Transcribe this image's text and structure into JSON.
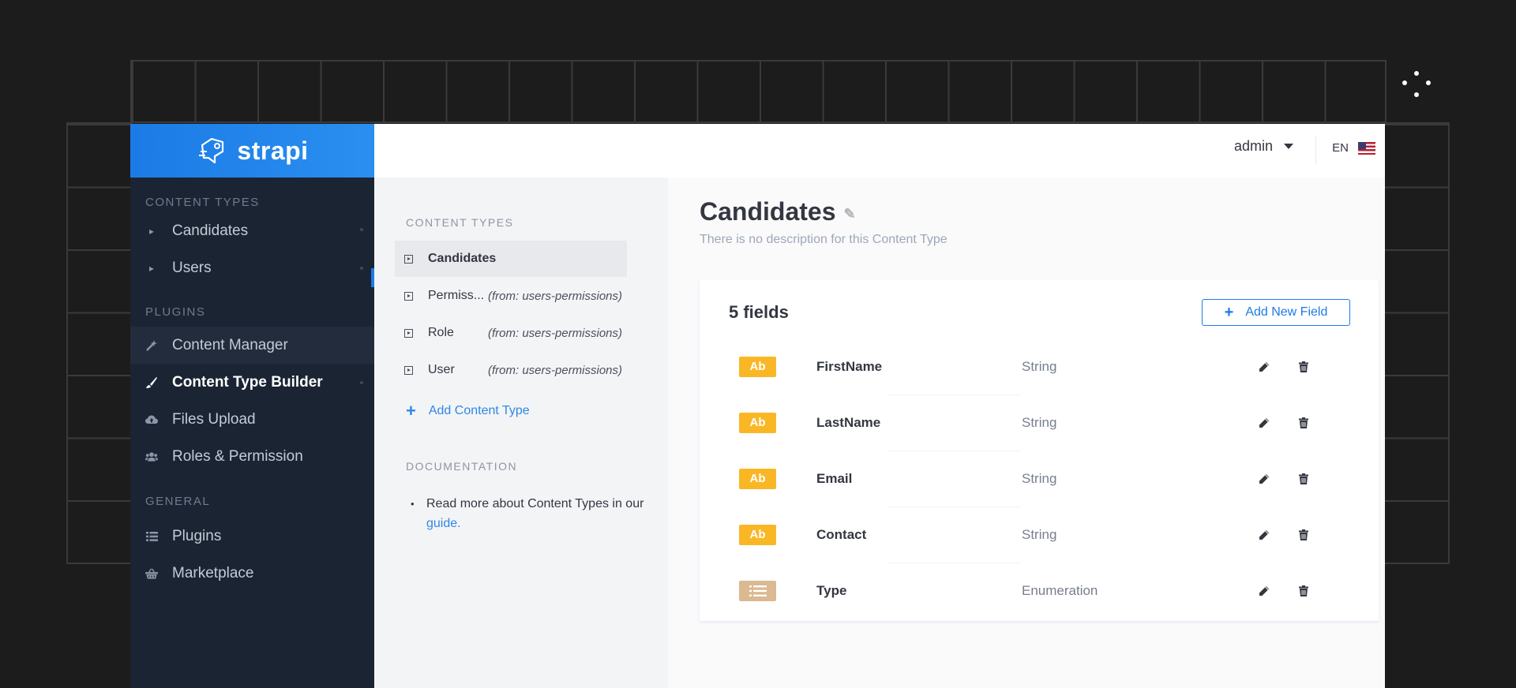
{
  "logo": {
    "text": "strapi"
  },
  "sidebar": {
    "sections": [
      {
        "title": "CONTENT TYPES",
        "items": [
          {
            "label": "Candidates",
            "icon": "caret-right-icon"
          },
          {
            "label": "Users",
            "icon": "caret-right-icon"
          }
        ]
      },
      {
        "title": "PLUGINS",
        "items": [
          {
            "label": "Content Manager",
            "icon": "wand-icon"
          },
          {
            "label": "Content Type Builder",
            "icon": "paint-brush-icon",
            "active": true
          },
          {
            "label": "Files Upload",
            "icon": "cloud-upload-icon"
          },
          {
            "label": "Roles & Permission",
            "icon": "users-icon"
          }
        ]
      },
      {
        "title": "GENERAL",
        "items": [
          {
            "label": "Plugins",
            "icon": "list-icon"
          },
          {
            "label": "Marketplace",
            "icon": "shopping-basket-icon"
          }
        ]
      }
    ]
  },
  "header": {
    "user": "admin",
    "lang": "EN"
  },
  "middle": {
    "content_types_title": "CONTENT TYPES",
    "items": [
      {
        "label": "Candidates",
        "from": ""
      },
      {
        "label": "Permiss...",
        "from": "(from: users-permissions)"
      },
      {
        "label": "Role",
        "from": "(from: users-permissions)"
      },
      {
        "label": "User",
        "from": "(from: users-permissions)"
      }
    ],
    "add_label": "Add Content Type",
    "documentation_title": "DOCUMENTATION",
    "doc_text": "Read more about Content Types in our",
    "doc_link": "guide."
  },
  "main": {
    "title": "Candidates",
    "description": "There is no description for this Content Type",
    "fields_count": "5 fields",
    "add_field_label": "Add New Field",
    "fields": [
      {
        "badge": "Ab",
        "name": "FirstName",
        "type": "String",
        "kind": "string"
      },
      {
        "badge": "Ab",
        "name": "LastName",
        "type": "String",
        "kind": "string"
      },
      {
        "badge": "Ab",
        "name": "Email",
        "type": "String",
        "kind": "string"
      },
      {
        "badge": "Ab",
        "name": "Contact",
        "type": "String",
        "kind": "string"
      },
      {
        "badge": "",
        "name": "Type",
        "type": "Enumeration",
        "kind": "enum"
      }
    ]
  },
  "colors": {
    "brand": "#1c7be6",
    "sidebar": "#1b2433",
    "string_badge": "#fab725",
    "enum_badge": "#dbb991"
  }
}
